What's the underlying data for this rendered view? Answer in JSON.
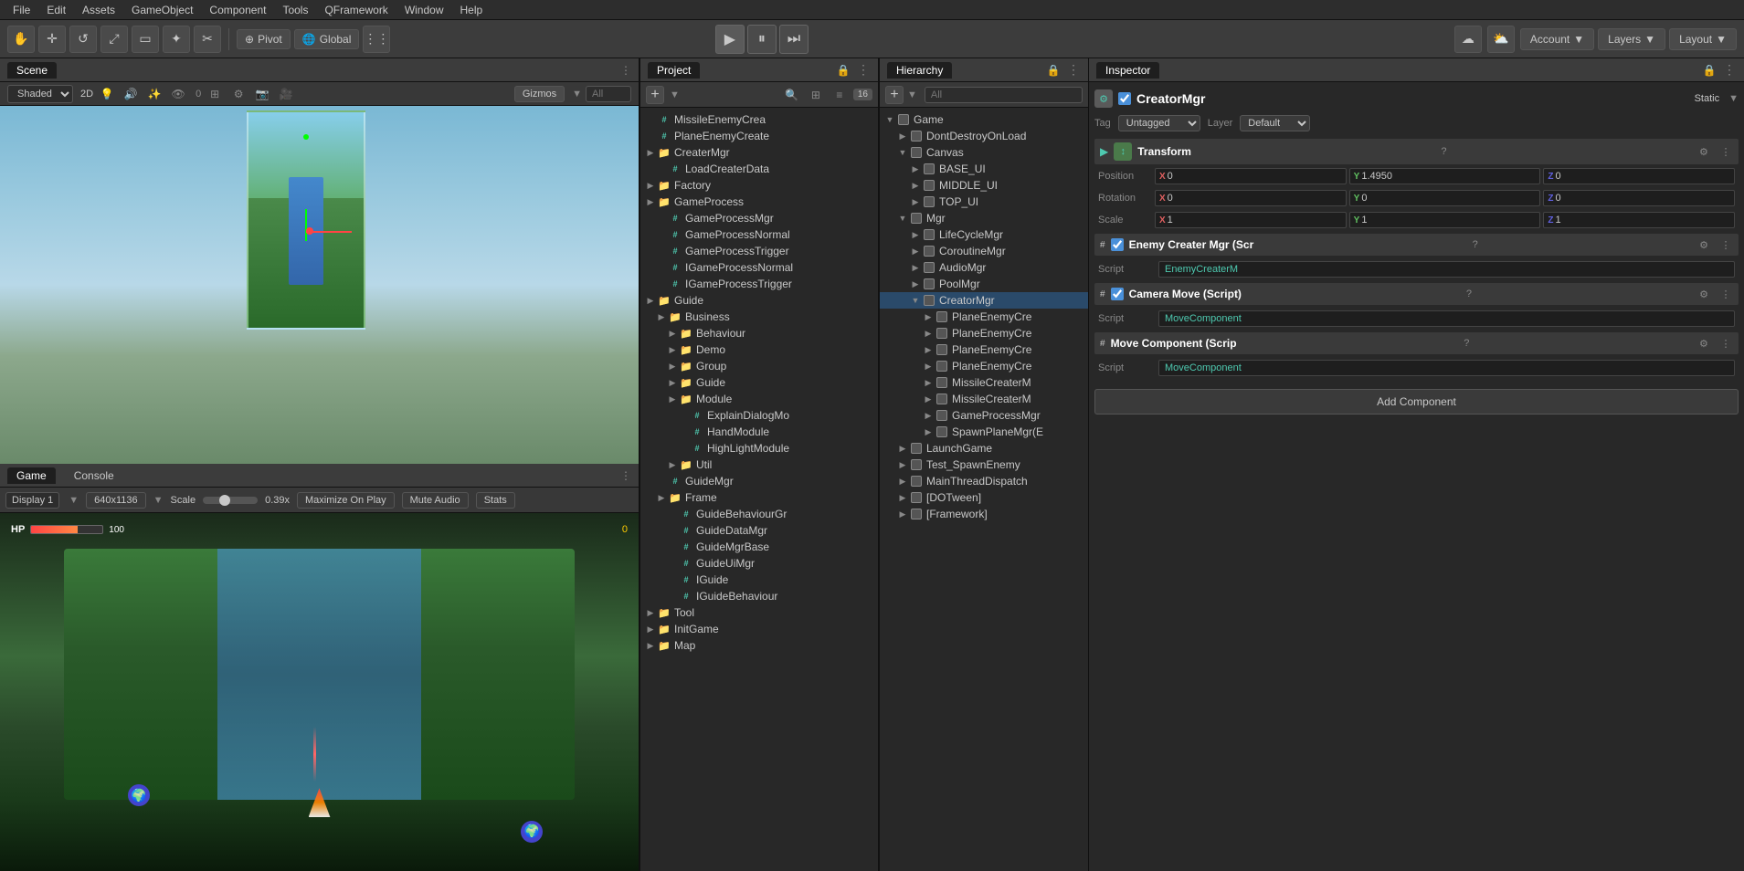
{
  "menubar": {
    "items": [
      "File",
      "Edit",
      "Assets",
      "GameObject",
      "Component",
      "Tools",
      "QFramework",
      "Window",
      "Help"
    ]
  },
  "toolbar": {
    "pivot_label": "Pivot",
    "global_label": "Global",
    "account_label": "Account",
    "layers_label": "Layers",
    "layout_label": "Layout"
  },
  "scene": {
    "tab_label": "Scene",
    "shaded": "Shaded",
    "two_d": "2D",
    "gizmos": "Gizmos",
    "all_placeholder": "All"
  },
  "game": {
    "tab_label": "Game",
    "console_tab": "Console",
    "display_label": "Display 1",
    "resolution": "640x1136",
    "scale_label": "Scale",
    "scale_value": "0.39x",
    "maximize_label": "Maximize On Play",
    "mute_label": "Mute Audio",
    "stats_label": "Stats"
  },
  "project": {
    "panel_label": "Project",
    "tree": [
      {
        "id": "missileenemycrea",
        "label": "MissileEnemyCrea",
        "type": "script",
        "indent": 0
      },
      {
        "id": "planeenemycreate",
        "label": "PlaneEnemyCreate",
        "type": "script",
        "indent": 0
      },
      {
        "id": "creatormgr",
        "label": "CreaterMgr",
        "type": "folder",
        "indent": 0
      },
      {
        "id": "loadcreaterdata",
        "label": "LoadCreaterData",
        "type": "script",
        "indent": 1
      },
      {
        "id": "factory",
        "label": "Factory",
        "type": "folder",
        "indent": 0
      },
      {
        "id": "gameprocess",
        "label": "GameProcess",
        "type": "folder",
        "indent": 0
      },
      {
        "id": "gameprocessmgr",
        "label": "GameProcessMgr",
        "type": "script",
        "indent": 1
      },
      {
        "id": "gameprocessnormal",
        "label": "GameProcessNormal",
        "type": "script",
        "indent": 1
      },
      {
        "id": "gameprocesstrigger",
        "label": "GameProcessTrigger",
        "type": "script",
        "indent": 1
      },
      {
        "id": "igameprocessnormal",
        "label": "IGameProcessNormal",
        "type": "script",
        "indent": 1
      },
      {
        "id": "igameprocesstrigger",
        "label": "IGameProcessTrigger",
        "type": "script",
        "indent": 1
      },
      {
        "id": "guide",
        "label": "Guide",
        "type": "folder",
        "indent": 0
      },
      {
        "id": "business",
        "label": "Business",
        "type": "folder",
        "indent": 1
      },
      {
        "id": "behaviour",
        "label": "Behaviour",
        "type": "folder",
        "indent": 2
      },
      {
        "id": "demo",
        "label": "Demo",
        "type": "folder",
        "indent": 2
      },
      {
        "id": "group",
        "label": "Group",
        "type": "folder",
        "indent": 2
      },
      {
        "id": "guide2",
        "label": "Guide",
        "type": "folder",
        "indent": 2
      },
      {
        "id": "module",
        "label": "Module",
        "type": "folder",
        "indent": 2
      },
      {
        "id": "explaindialogmod",
        "label": "ExplainDialogMo",
        "type": "script",
        "indent": 3
      },
      {
        "id": "handmodule",
        "label": "HandModule",
        "type": "script",
        "indent": 3
      },
      {
        "id": "highlightmodule",
        "label": "HighLightModule",
        "type": "script",
        "indent": 3
      },
      {
        "id": "util",
        "label": "Util",
        "type": "folder",
        "indent": 2
      },
      {
        "id": "guidemgr",
        "label": "GuideMgr",
        "type": "script",
        "indent": 1
      },
      {
        "id": "frame",
        "label": "Frame",
        "type": "folder",
        "indent": 1
      },
      {
        "id": "guidebehaviourgr",
        "label": "GuideBehaviourGr",
        "type": "script",
        "indent": 2
      },
      {
        "id": "guidedatamgr",
        "label": "GuideDataMgr",
        "type": "script",
        "indent": 2
      },
      {
        "id": "guidemgrbase",
        "label": "GuideMgrBase",
        "type": "script",
        "indent": 2
      },
      {
        "id": "guideuimgr",
        "label": "GuideUiMgr",
        "type": "script",
        "indent": 2
      },
      {
        "id": "iguide",
        "label": "IGuide",
        "type": "script",
        "indent": 2
      },
      {
        "id": "iguidebehaviour",
        "label": "IGuideBehaviour",
        "type": "script",
        "indent": 2
      },
      {
        "id": "tool",
        "label": "Tool",
        "type": "folder",
        "indent": 0
      },
      {
        "id": "initgame",
        "label": "InitGame",
        "type": "folder",
        "indent": 0
      },
      {
        "id": "map",
        "label": "Map",
        "type": "folder",
        "indent": 0
      }
    ]
  },
  "hierarchy": {
    "panel_label": "Hierarchy",
    "search_placeholder": "All",
    "tree": [
      {
        "id": "game",
        "label": "Game",
        "type": "gameobj",
        "indent": 0,
        "expanded": true
      },
      {
        "id": "dontdestroyonload",
        "label": "DontDestroyOnLoad",
        "type": "gameobj",
        "indent": 1,
        "expanded": false
      },
      {
        "id": "canvas",
        "label": "Canvas",
        "type": "gameobj",
        "indent": 1,
        "expanded": true
      },
      {
        "id": "base_ui",
        "label": "BASE_UI",
        "type": "gameobj",
        "indent": 2,
        "expanded": false
      },
      {
        "id": "middle_ui",
        "label": "MIDDLE_UI",
        "type": "gameobj",
        "indent": 2,
        "expanded": false
      },
      {
        "id": "top_ui",
        "label": "TOP_UI",
        "type": "gameobj",
        "indent": 2,
        "expanded": false
      },
      {
        "id": "mgr",
        "label": "Mgr",
        "type": "gameobj",
        "indent": 1,
        "expanded": true
      },
      {
        "id": "lifecyclemgr",
        "label": "LifeCycleMgr",
        "type": "gameobj",
        "indent": 2,
        "expanded": false
      },
      {
        "id": "coroutinemgr",
        "label": "CoroutineMgr",
        "type": "gameobj",
        "indent": 2,
        "expanded": false
      },
      {
        "id": "audiomgr",
        "label": "AudioMgr",
        "type": "gameobj",
        "indent": 2,
        "expanded": false
      },
      {
        "id": "poolmgr",
        "label": "PoolMgr",
        "type": "gameobj",
        "indent": 2,
        "expanded": false
      },
      {
        "id": "creatormgr_h",
        "label": "CreatorMgr",
        "type": "gameobj",
        "indent": 2,
        "expanded": true,
        "selected": true
      },
      {
        "id": "planeenemycre1",
        "label": "PlaneEnemyCre",
        "type": "gameobj",
        "indent": 3,
        "expanded": false
      },
      {
        "id": "planeenemycre2",
        "label": "PlaneEnemyCre",
        "type": "gameobj",
        "indent": 3,
        "expanded": false
      },
      {
        "id": "planeenemycre3",
        "label": "PlaneEnemyCre",
        "type": "gameobj",
        "indent": 3,
        "expanded": false
      },
      {
        "id": "planeenemycre4",
        "label": "PlaneEnemyCre",
        "type": "gameobj",
        "indent": 3,
        "expanded": false
      },
      {
        "id": "missilecreatorm1",
        "label": "MissileCreaterM",
        "type": "gameobj",
        "indent": 3,
        "expanded": false
      },
      {
        "id": "missilecreatorm2",
        "label": "MissileCreaterM",
        "type": "gameobj",
        "indent": 3,
        "expanded": false
      },
      {
        "id": "gameprocessmgr_h",
        "label": "GameProcessMgr",
        "type": "gameobj",
        "indent": 3,
        "expanded": false
      },
      {
        "id": "spawnplanemgr",
        "label": "SpawnPlaneMgr(E",
        "type": "gameobj",
        "indent": 3,
        "expanded": false
      },
      {
        "id": "launchgame",
        "label": "LaunchGame",
        "type": "gameobj",
        "indent": 1,
        "expanded": false
      },
      {
        "id": "test_spawnenemy",
        "label": "Test_SpawnEnemy",
        "type": "gameobj",
        "indent": 1,
        "expanded": false
      },
      {
        "id": "mainthreaddispatch",
        "label": "MainThreadDispatch",
        "type": "gameobj",
        "indent": 1,
        "expanded": false
      },
      {
        "id": "dotween",
        "label": "[DOTween]",
        "type": "gameobj",
        "indent": 1,
        "expanded": false
      },
      {
        "id": "framework",
        "label": "[Framework]",
        "type": "gameobj",
        "indent": 1,
        "expanded": false
      }
    ]
  },
  "inspector": {
    "panel_label": "Inspector",
    "object_name": "CreatorMgr",
    "static_label": "Static",
    "tag_label": "Tag",
    "tag_value": "Untagged",
    "layer_label": "Layer",
    "layer_value": "Default",
    "transform": {
      "label": "Transform",
      "position_label": "Position",
      "pos_x": "0",
      "pos_y": "1.4950",
      "pos_z": "0",
      "rotation_label": "Rotation",
      "rot_x": "0",
      "rot_y": "0",
      "rot_z": "0",
      "scale_label": "Scale",
      "scale_x": "1",
      "scale_y": "1",
      "scale_z": "1"
    },
    "enemy_creater": {
      "label": "Enemy Creater Mgr (Scr",
      "script_label": "Script",
      "script_value": "EnemyCreaterM"
    },
    "camera_move": {
      "label": "Camera Move (Script)",
      "script_label": "Script",
      "script_value": "MoveComponent"
    },
    "move_component": {
      "label": "Move Component (Scrip",
      "script_label": "Script",
      "script_value": "MoveComponent"
    },
    "add_component_label": "Add Component"
  }
}
